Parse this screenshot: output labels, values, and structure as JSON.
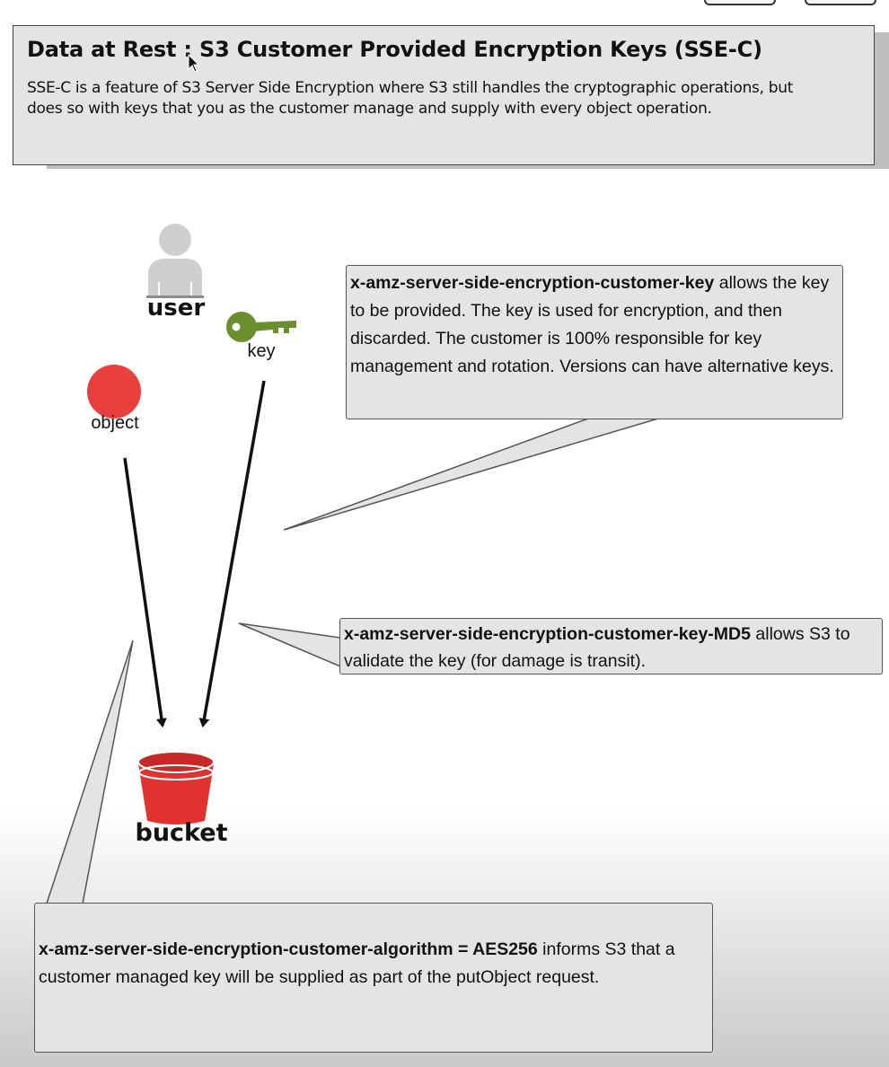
{
  "header": {
    "title": "Data at Rest : S3 Customer Provided Encryption Keys (SSE-C)",
    "description": "SSE-C is a feature of S3 Server Side Encryption where S3 still handles the cryptographic operations, but does so with keys that you as the customer manage and supply with every object operation."
  },
  "nodes": {
    "user": "user",
    "key": "key",
    "object": "object",
    "bucket": "bucket"
  },
  "callouts": {
    "customer_key": {
      "term": "x-amz-server-side-encryption-customer-key",
      "text": " allows the key to be provided. The key is used for encryption, and then discarded. The customer is 100% responsible for key management and rotation. Versions can have alternative keys."
    },
    "key_md5": {
      "term": "x-amz-server-side-encryption-customer-key-MD5",
      "text": " allows S3 to validate the key (for damage is transit)."
    },
    "algorithm": {
      "term": "x-amz-server-side-encryption-customer-algorithm = AES256",
      "text": " informs S3 that a customer managed key will be supplied as part of the putObject request."
    }
  },
  "colors": {
    "panel": "#e4e4e4",
    "object_red": "#e8403f",
    "bucket_red": "#e0322f",
    "key_green": "#6b8e2f",
    "user_gray": "#cfcfcf"
  },
  "icons": [
    "user-icon",
    "key-icon",
    "object-icon",
    "bucket-icon",
    "cursor-icon"
  ]
}
